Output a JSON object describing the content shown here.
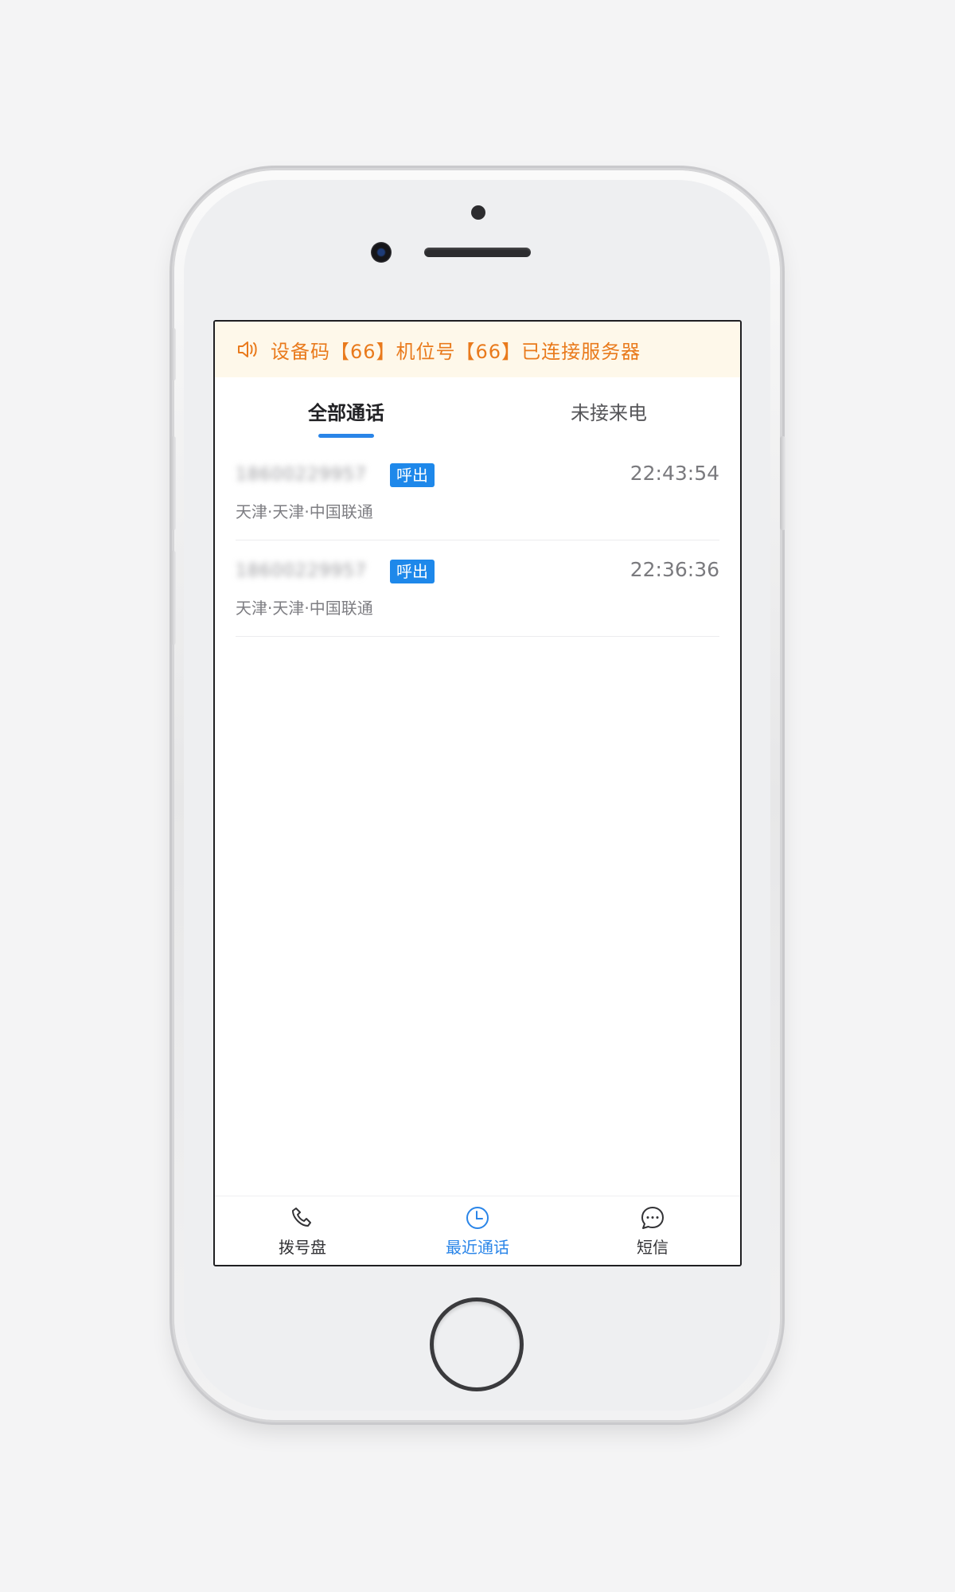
{
  "notice": {
    "icon": "speaker-icon",
    "text": "设备码【66】机位号【66】已连接服务器",
    "color": "#e97a1c"
  },
  "tabs": [
    {
      "label": "全部通话",
      "active": true
    },
    {
      "label": "未接来电",
      "active": false
    }
  ],
  "calls": [
    {
      "number": "18600229957",
      "badge": "呼出",
      "time": "22:43:54",
      "location": "天津·天津·中国联通"
    },
    {
      "number": "18600229957",
      "badge": "呼出",
      "time": "22:36:36",
      "location": "天津·天津·中国联通"
    }
  ],
  "bottom_nav": [
    {
      "label": "拨号盘",
      "icon": "phone-icon",
      "active": false
    },
    {
      "label": "最近通话",
      "icon": "clock-icon",
      "active": true
    },
    {
      "label": "短信",
      "icon": "chat-bubble-icon",
      "active": false
    }
  ],
  "accent_color": "#2a85e8"
}
